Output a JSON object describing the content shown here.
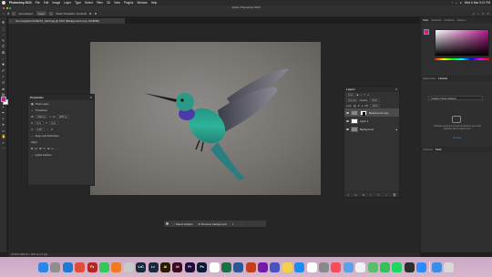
{
  "menubar": {
    "app_name": "Photoshop 2024",
    "items": [
      "File",
      "Edit",
      "Image",
      "Layer",
      "Type",
      "Select",
      "Filter",
      "3D",
      "View",
      "Plugins",
      "Window",
      "Help"
    ],
    "clock": "Wed 6 Mar 9:21 PM"
  },
  "window": {
    "title": "Adobe Photoshop 2024"
  },
  "optionsbar": {
    "select_label": "Auto-Select:",
    "select_value": "Layer",
    "transform_label": "Show Transform Controls"
  },
  "document": {
    "tab_title": "hummingbird-2139279_1920.jpg @ 33% (Background copy, RGB/8#)"
  },
  "taskbar": {
    "select_subject": "Select subject",
    "remove_background": "Remove background"
  },
  "properties": {
    "title": "Properties",
    "kind": "Pixel Layer",
    "transform_heading": "Transform",
    "w_label": "W",
    "w_value": "1920 px",
    "h_label": "H",
    "h_value": "1280 px",
    "x_label": "X",
    "x_value": "0 px",
    "y_label": "Y",
    "y_value": "0 px",
    "angle_value": "0.00°",
    "align_heading": "Align and Distribute",
    "align_label": "Align:",
    "quick_actions": "Quick Actions"
  },
  "layers": {
    "title": "Layers",
    "kind": "Kind",
    "blend": "Normal",
    "opacity_label": "Opacity:",
    "opacity_value": "100%",
    "lock_label": "Lock:",
    "fill_label": "Fill:",
    "fill_value": "100%",
    "items": [
      {
        "name": "Background copy",
        "active": true
      },
      {
        "name": "Layer 1",
        "active": false
      },
      {
        "name": "Background",
        "active": false
      }
    ]
  },
  "dock": {
    "tabs_top": [
      "Color",
      "Swatches",
      "Gradients",
      "Patterns"
    ],
    "tabs_mid": [
      "Adjustments",
      "Libraries"
    ],
    "library_select": "Creative Cloud Libraries",
    "library_message": "Libraries syncing is turned off. Resume sync and Libraries will be visible here.",
    "library_link": "Resume",
    "tabs_bottom": [
      "Channels",
      "Paths"
    ]
  },
  "status": {
    "text": "33.33%    1920 px x 1280 px (72 ppi)"
  },
  "colors": {
    "foreground": "#d0189a",
    "background": "#ffffff",
    "accent": "#b6178f"
  },
  "macdock": {
    "apps": [
      {
        "name": "finder-icon",
        "label": "",
        "color": "#2b86e8"
      },
      {
        "name": "launchpad-icon",
        "label": "",
        "color": "#8f8f8f"
      },
      {
        "name": "vscode-icon",
        "label": "",
        "color": "#1f7ad4"
      },
      {
        "name": "chrome-icon",
        "label": "",
        "color": "#e24c3d"
      },
      {
        "name": "filezilla-icon",
        "label": "Fz",
        "color": "#b42524"
      },
      {
        "name": "messages-icon",
        "label": "",
        "color": "#34c759"
      },
      {
        "name": "firefox-icon",
        "label": "",
        "color": "#ef7a22"
      },
      {
        "name": "unknown-app-icon",
        "label": "",
        "color": "#c9c9c9"
      },
      {
        "name": "lightroom-classic-icon",
        "label": "LrC",
        "color": "#1a2a3d"
      },
      {
        "name": "lightroom-icon",
        "label": "Lr",
        "color": "#1a2a3d"
      },
      {
        "name": "illustrator-icon",
        "label": "Ai",
        "color": "#2a1a00"
      },
      {
        "name": "indesign-icon",
        "label": "Id",
        "color": "#3b0a1e"
      },
      {
        "name": "premiere-icon",
        "label": "Pr",
        "color": "#1e0a3b"
      },
      {
        "name": "photoshop-icon",
        "label": "Ps",
        "color": "#0b1b34"
      },
      {
        "name": "reminders-icon",
        "label": "",
        "color": "#ffffff"
      },
      {
        "name": "excel-icon",
        "label": "",
        "color": "#1d7044"
      },
      {
        "name": "word-icon",
        "label": "",
        "color": "#2b5797"
      },
      {
        "name": "powerpoint-icon",
        "label": "",
        "color": "#c43e1c"
      },
      {
        "name": "onenote-icon",
        "label": "",
        "color": "#7719aa"
      },
      {
        "name": "teams-icon",
        "label": "",
        "color": "#4b53bc"
      },
      {
        "name": "notes-icon",
        "label": "",
        "color": "#f2d34b"
      },
      {
        "name": "app-store-icon",
        "label": "",
        "color": "#1c8cf0"
      },
      {
        "name": "calendar-icon",
        "label": "",
        "color": "#ffffff"
      },
      {
        "name": "system-settings-icon",
        "label": "",
        "color": "#8a8a8a"
      },
      {
        "name": "music-icon",
        "label": "",
        "color": "#f94c57"
      },
      {
        "name": "preview-icon",
        "label": "",
        "color": "#5ea0e8"
      },
      {
        "name": "photos-icon",
        "label": "",
        "color": "#f1f1f1"
      },
      {
        "name": "maps-icon",
        "label": "",
        "color": "#5bbf6a"
      },
      {
        "name": "facetime-icon",
        "label": "",
        "color": "#35c05a"
      },
      {
        "name": "spotify-icon",
        "label": "",
        "color": "#1ed760"
      },
      {
        "name": "chatgpt-icon",
        "label": "",
        "color": "#2e2e2e"
      },
      {
        "name": "zoom-icon",
        "label": "",
        "color": "#2d8cff"
      },
      {
        "name": "downloads-icon",
        "label": "",
        "color": "#3a8ee6"
      },
      {
        "name": "trash-icon",
        "label": "",
        "color": "#d9d9d9"
      }
    ]
  }
}
